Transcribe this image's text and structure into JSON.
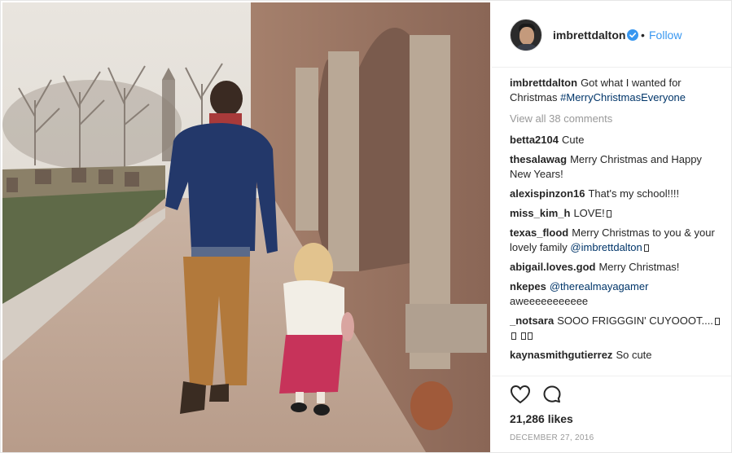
{
  "post": {
    "username": "imbrettdalton",
    "verified": true,
    "separator": "•",
    "follow_label": "Follow",
    "caption": {
      "username": "imbrettdalton",
      "text": "Got what I wanted for Christmas",
      "hashtag": "#MerryChristmasEveryone"
    },
    "view_all_comments": "View all 38 comments",
    "comments": [
      {
        "user": "betta2104",
        "text": "Cute"
      },
      {
        "user": "thesalawag",
        "text": "Merry Christmas and Happy New Years!"
      },
      {
        "user": "alexispinzon16",
        "text": "That's my school!!!!"
      },
      {
        "user": "miss_kim_h",
        "text": "LOVE!"
      },
      {
        "user": "texas_flood",
        "text": "Merry Christmas to you & your lovely family",
        "mention": "@imbrettdalton"
      },
      {
        "user": "abigail.loves.god",
        "text": "Merry Christmas!"
      },
      {
        "user": "nkepes",
        "mention": "@therealmayagamer",
        "text": "aweeeeeeeeeee"
      },
      {
        "user": "_notsara",
        "text": "SOOO FRIGGGIN' CUYOOOT...."
      },
      {
        "user": "kaynasmithgutierrez",
        "text": "So cute"
      }
    ],
    "likes": "21,286 likes",
    "date": "DECEMBER 27, 2016",
    "icons": {
      "like": "heart-icon",
      "comment": "comment-icon",
      "verified": "verified-badge-icon"
    },
    "colors": {
      "link": "#3897f0",
      "verified": "#3897f0",
      "muted": "#999999"
    }
  }
}
